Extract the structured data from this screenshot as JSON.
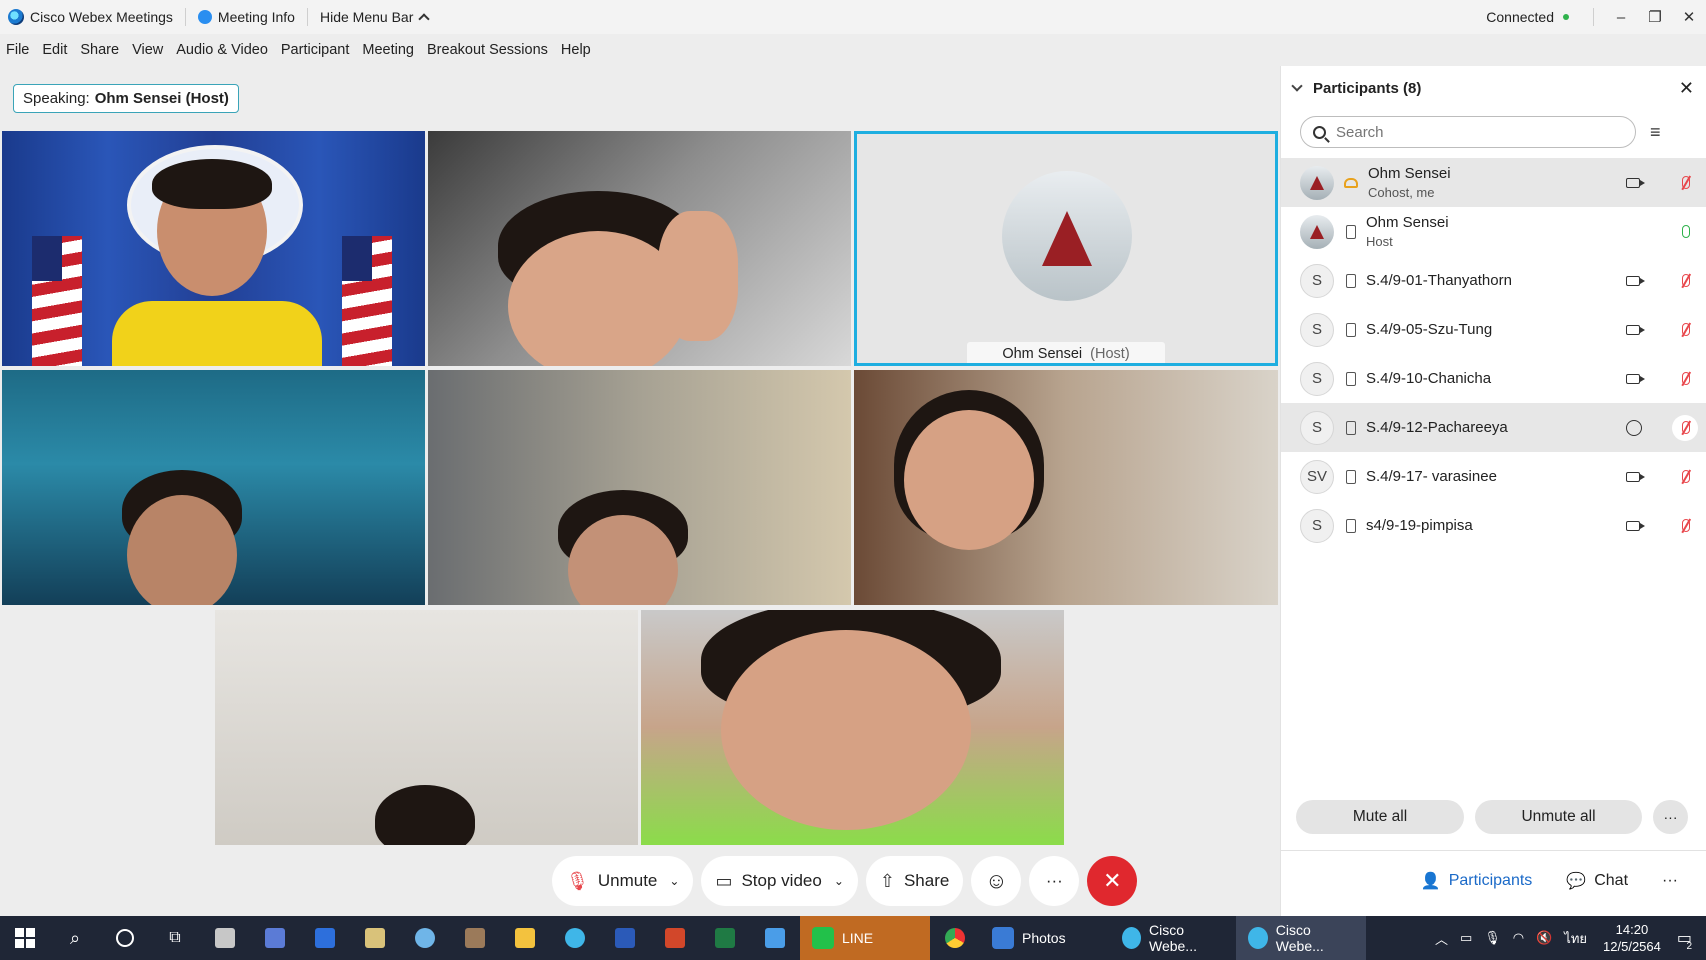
{
  "titlebar": {
    "app_title": "Cisco Webex Meetings",
    "meeting_info": "Meeting Info",
    "hide_menu": "Hide Menu Bar",
    "status": "Connected",
    "win_min": "–",
    "win_max": "❐",
    "win_close": "✕"
  },
  "menu": [
    "File",
    "Edit",
    "Share",
    "View",
    "Audio & Video",
    "Participant",
    "Meeting",
    "Breakout Sessions",
    "Help"
  ],
  "speaking": {
    "label": "Speaking:",
    "name": "Ohm Sensei (Host)"
  },
  "featured_tile": {
    "name": "Ohm Sensei",
    "role": "(Host)"
  },
  "controls": {
    "unmute": "Unmute",
    "stop_video": "Stop video",
    "share": "Share",
    "reactions_icon": "☺",
    "more": "···",
    "end_icon": "✕"
  },
  "participants_panel": {
    "title": "Participants (8)",
    "close": "✕",
    "search_placeholder": "Search",
    "sort_icon": "≡",
    "participants": [
      {
        "name": "Ohm Sensei",
        "sub": "Cohost, me"
      },
      {
        "name": "Ohm Sensei",
        "sub": "Host"
      },
      {
        "initials": "S",
        "name": "S.4/9-01-Thanyathorn"
      },
      {
        "initials": "S",
        "name": "S.4/9-05-Szu-Tung"
      },
      {
        "initials": "S",
        "name": "S.4/9-10-Chanicha"
      },
      {
        "initials": "S",
        "name": "S.4/9-12-Pachareeya"
      },
      {
        "initials": "SV",
        "name": "S.4/9-17- varasinee"
      },
      {
        "initials": "S",
        "name": "s4/9-19-pimpisa"
      }
    ],
    "mute_all": "Mute all",
    "unmute_all": "Unmute all",
    "more": "···"
  },
  "tabs": {
    "participants": "Participants",
    "chat": "Chat",
    "more": "···"
  },
  "taskbar": {
    "line": "LINE",
    "photos": "Photos",
    "webex1": "Cisco Webe...",
    "webex2": "Cisco Webe...",
    "lang": "ไทย",
    "time": "14:20",
    "date": "12/5/2564",
    "notifications": "2"
  }
}
